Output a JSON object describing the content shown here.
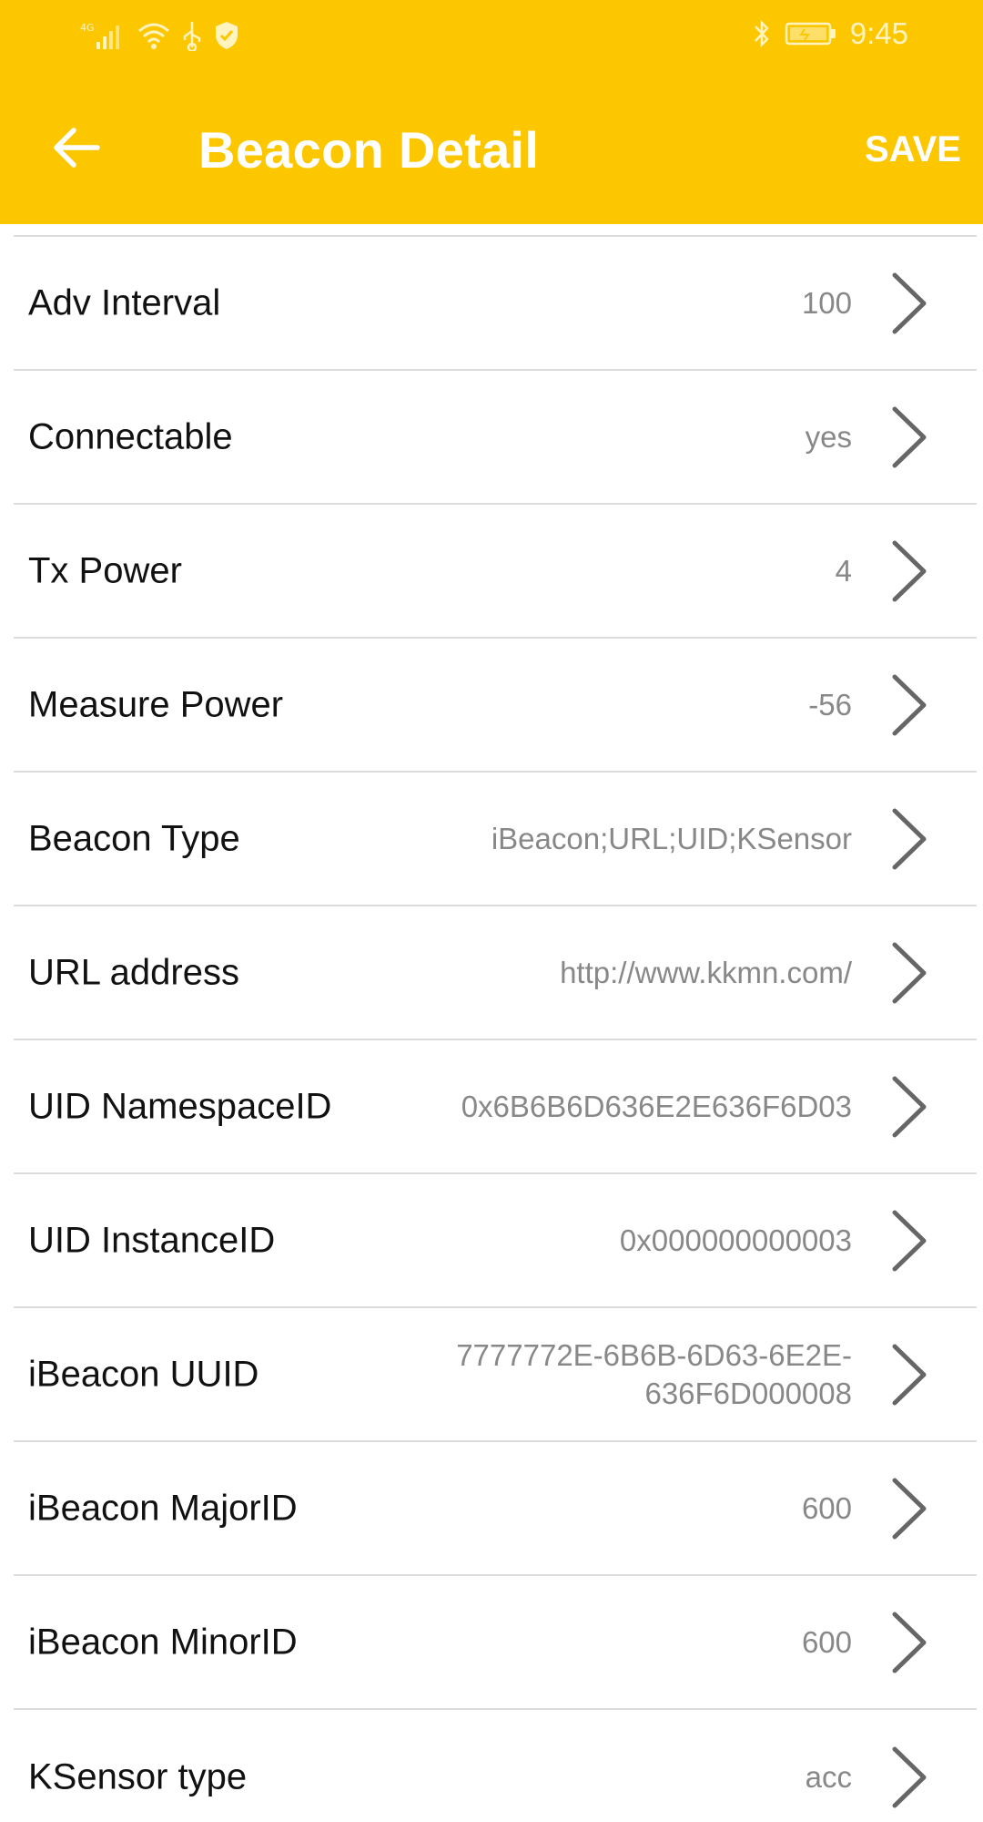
{
  "status_bar": {
    "time": "9:45",
    "network_label": "4G",
    "icons": [
      "signal-icon",
      "wifi-icon",
      "usb-icon",
      "shield-icon",
      "bluetooth-icon",
      "battery-icon"
    ]
  },
  "appbar": {
    "title": "Beacon Detail",
    "save_label": "SAVE",
    "back_icon": "arrow-left-icon",
    "color": "#FDC700"
  },
  "rows": [
    {
      "label": "Adv Interval",
      "value": "100"
    },
    {
      "label": "Connectable",
      "value": "yes"
    },
    {
      "label": "Tx Power",
      "value": "4"
    },
    {
      "label": "Measure Power",
      "value": "-56"
    },
    {
      "label": "Beacon Type",
      "value": "iBeacon;URL;UID;KSensor"
    },
    {
      "label": "URL address",
      "value": "http://www.kkmn.com/"
    },
    {
      "label": "UID NamespaceID",
      "value": "0x6B6B6D636E2E636F6D03"
    },
    {
      "label": "UID InstanceID",
      "value": "0x000000000003"
    },
    {
      "label": "iBeacon UUID",
      "value_line1": "7777772E-6B6B-6D63-6E2E-",
      "value_line2": "636F6D000008"
    },
    {
      "label": "iBeacon MajorID",
      "value": "600"
    },
    {
      "label": "iBeacon MinorID",
      "value": "600"
    },
    {
      "label": "KSensor type",
      "value": "acc"
    }
  ]
}
